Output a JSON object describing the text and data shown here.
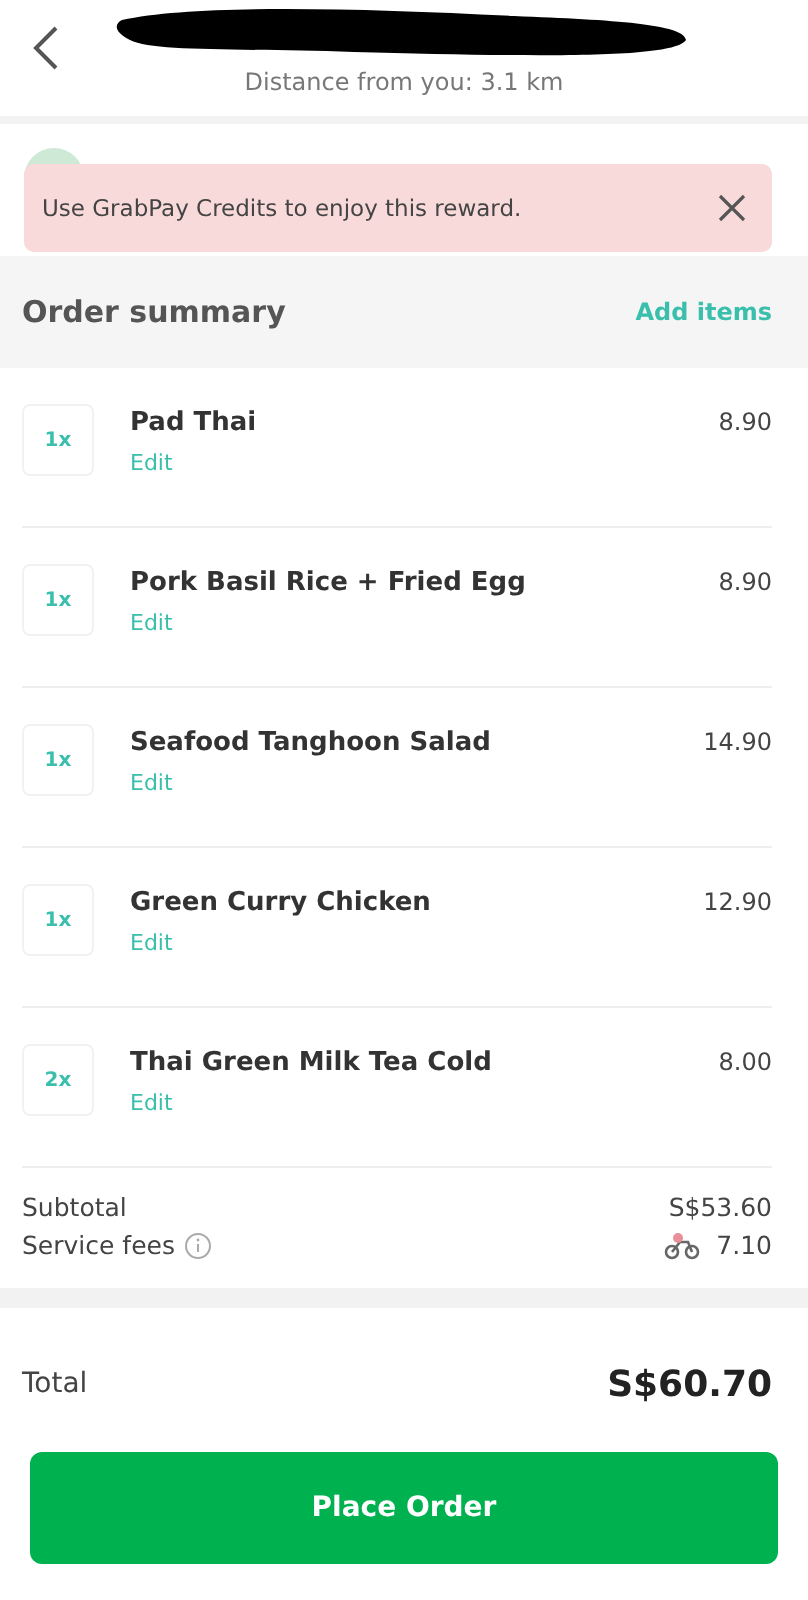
{
  "header": {
    "distance": "Distance from you: 3.1 km"
  },
  "toast": {
    "message": "Use GrabPay Credits to enjoy this reward."
  },
  "summary": {
    "title": "Order summary",
    "action": "Add items"
  },
  "items": [
    {
      "qty": "1x",
      "name": "Pad Thai",
      "edit": "Edit",
      "price": "8.90"
    },
    {
      "qty": "1x",
      "name": "Pork Basil Rice + Fried Egg",
      "edit": "Edit",
      "price": "8.90"
    },
    {
      "qty": "1x",
      "name": "Seafood Tanghoon Salad",
      "edit": "Edit",
      "price": "14.90"
    },
    {
      "qty": "1x",
      "name": "Green Curry Chicken",
      "edit": "Edit",
      "price": "12.90"
    },
    {
      "qty": "2x",
      "name": "Thai Green Milk Tea Cold",
      "edit": "Edit",
      "price": "8.00"
    }
  ],
  "fees": [
    {
      "label": "Subtotal",
      "value": "S$53.60",
      "info": false,
      "scooter": false
    },
    {
      "label": "Service fees",
      "value": "7.10",
      "info": true,
      "scooter": true
    }
  ],
  "total": {
    "label": "Total",
    "value": "S$60.70"
  },
  "button": "Place Order"
}
